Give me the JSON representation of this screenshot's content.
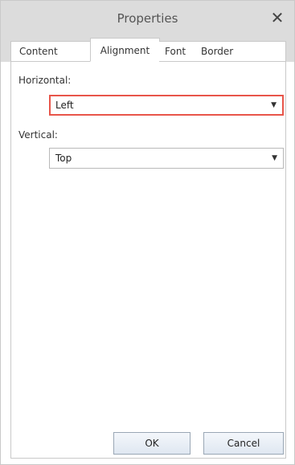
{
  "window": {
    "title": "Properties",
    "close_glyph": "✕",
    "close_icon": "close-icon"
  },
  "tabs": [
    {
      "label": "Content",
      "active": false
    },
    {
      "label": "Alignment",
      "active": true
    },
    {
      "label": "Font",
      "active": false
    },
    {
      "label": "Border",
      "active": false
    }
  ],
  "alignment": {
    "horizontal_label": "Horizontal:",
    "horizontal_value": "Left",
    "vertical_label": "Vertical:",
    "vertical_value": "Top",
    "dropdown_icon": "chevron-down-icon"
  },
  "buttons": {
    "ok": "OK",
    "cancel": "Cancel"
  },
  "colors": {
    "titlebar": "#dcdcdc",
    "focus_border": "#e8554a"
  }
}
